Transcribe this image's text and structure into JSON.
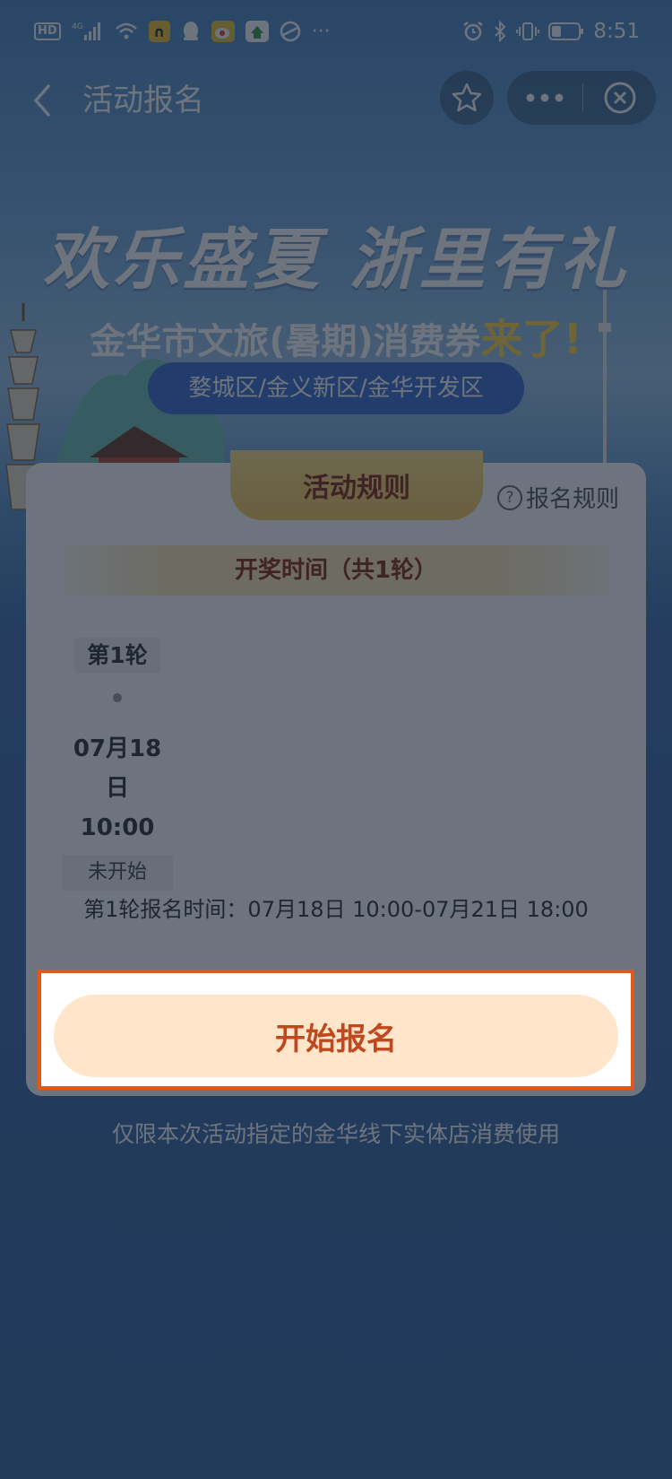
{
  "status_bar": {
    "hd": "HD",
    "network": "4G",
    "time": "8:51",
    "icons_left": [
      "hd-icon",
      "signal-icon",
      "wifi-icon",
      "app-icon",
      "qq-icon",
      "weibo-icon",
      "app-icon-2",
      "browser-icon",
      "more-notifications-icon"
    ],
    "icons_right": [
      "alarm-icon",
      "bluetooth-icon",
      "vibrate-icon",
      "battery-icon"
    ],
    "more": "···"
  },
  "navbar": {
    "title": "活动报名"
  },
  "banner": {
    "slogan": "欢乐盛夏 浙里有礼",
    "subtitle_main": "金华市文旅(暑期)消费券",
    "subtitle_highlight": "来了!",
    "districts": "婺城区/金义新区/金华开发区"
  },
  "card": {
    "ribbon": "活动规则",
    "rules_link": "报名规则",
    "draw_header": "开奖时间（共1轮）",
    "round": {
      "label": "第1轮",
      "date": "07月18日",
      "time": "10:00",
      "status": "未开始"
    },
    "registration_time": "第1轮报名时间：07月18日 10:00-07月21日 18:00"
  },
  "start_button": "开始报名",
  "footer_note": "仅限本次活动指定的金华线下实体店消费使用",
  "colors": {
    "overlay_bg": "#233653",
    "accent": "#c0471e",
    "highlight_border": "#e2581a",
    "button_fill": "#ffe6cb",
    "ribbon": "#f7c659"
  }
}
